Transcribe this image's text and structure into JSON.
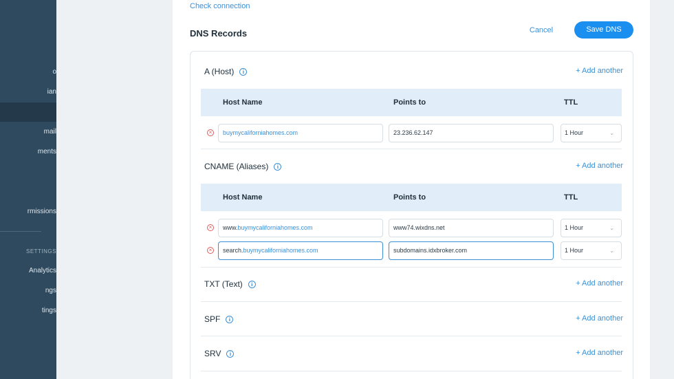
{
  "sidebar": {
    "items": [
      {
        "label": "o",
        "active": false
      },
      {
        "label": "ian",
        "active": false
      },
      {
        "label": "",
        "active": true
      },
      {
        "label": "mail",
        "active": false
      },
      {
        "label": "ments",
        "active": false
      },
      {
        "label": "rmissions",
        "active": false
      }
    ],
    "section_label": "SETTINGS",
    "section_items": [
      {
        "label": "Analytics"
      },
      {
        "label": "ngs"
      },
      {
        "label": "tings"
      }
    ]
  },
  "header": {
    "check_connection": "Check connection",
    "title": "DNS Records",
    "cancel_label": "Cancel",
    "save_label": "Save DNS"
  },
  "columns": {
    "host": "Host Name",
    "points": "Points to",
    "ttl": "TTL"
  },
  "add_another": "+ Add another",
  "sections": {
    "a": {
      "title": "A (Host)",
      "rows": [
        {
          "host_prefix": "",
          "host_domain": "buymycaliforniahomes.com",
          "points_to": "23.236.62.147",
          "ttl": "1 Hour"
        }
      ]
    },
    "cname": {
      "title": "CNAME (Aliases)",
      "rows": [
        {
          "host_prefix": "www.",
          "host_domain": "buymycaliforniahomes.com",
          "points_to": "www74.wixdns.net",
          "ttl": "1 Hour"
        },
        {
          "host_prefix": "search.",
          "host_domain": "buymycaliforniahomes.com",
          "points_to": "subdomains.idxbroker.com",
          "ttl": "1 Hour"
        }
      ]
    },
    "txt": {
      "title": "TXT (Text)"
    },
    "spf": {
      "title": "SPF"
    },
    "srv": {
      "title": "SRV"
    }
  },
  "colors": {
    "accent": "#1a8ff0",
    "link": "#3b8fd6",
    "sidebar": "#2f4a5e",
    "header_row": "#e1edf8",
    "delete": "#e05a5a"
  },
  "icons": {
    "info": "info-circle-icon",
    "delete": "remove-circle-icon",
    "dropdown": "chevron-down-icon"
  }
}
